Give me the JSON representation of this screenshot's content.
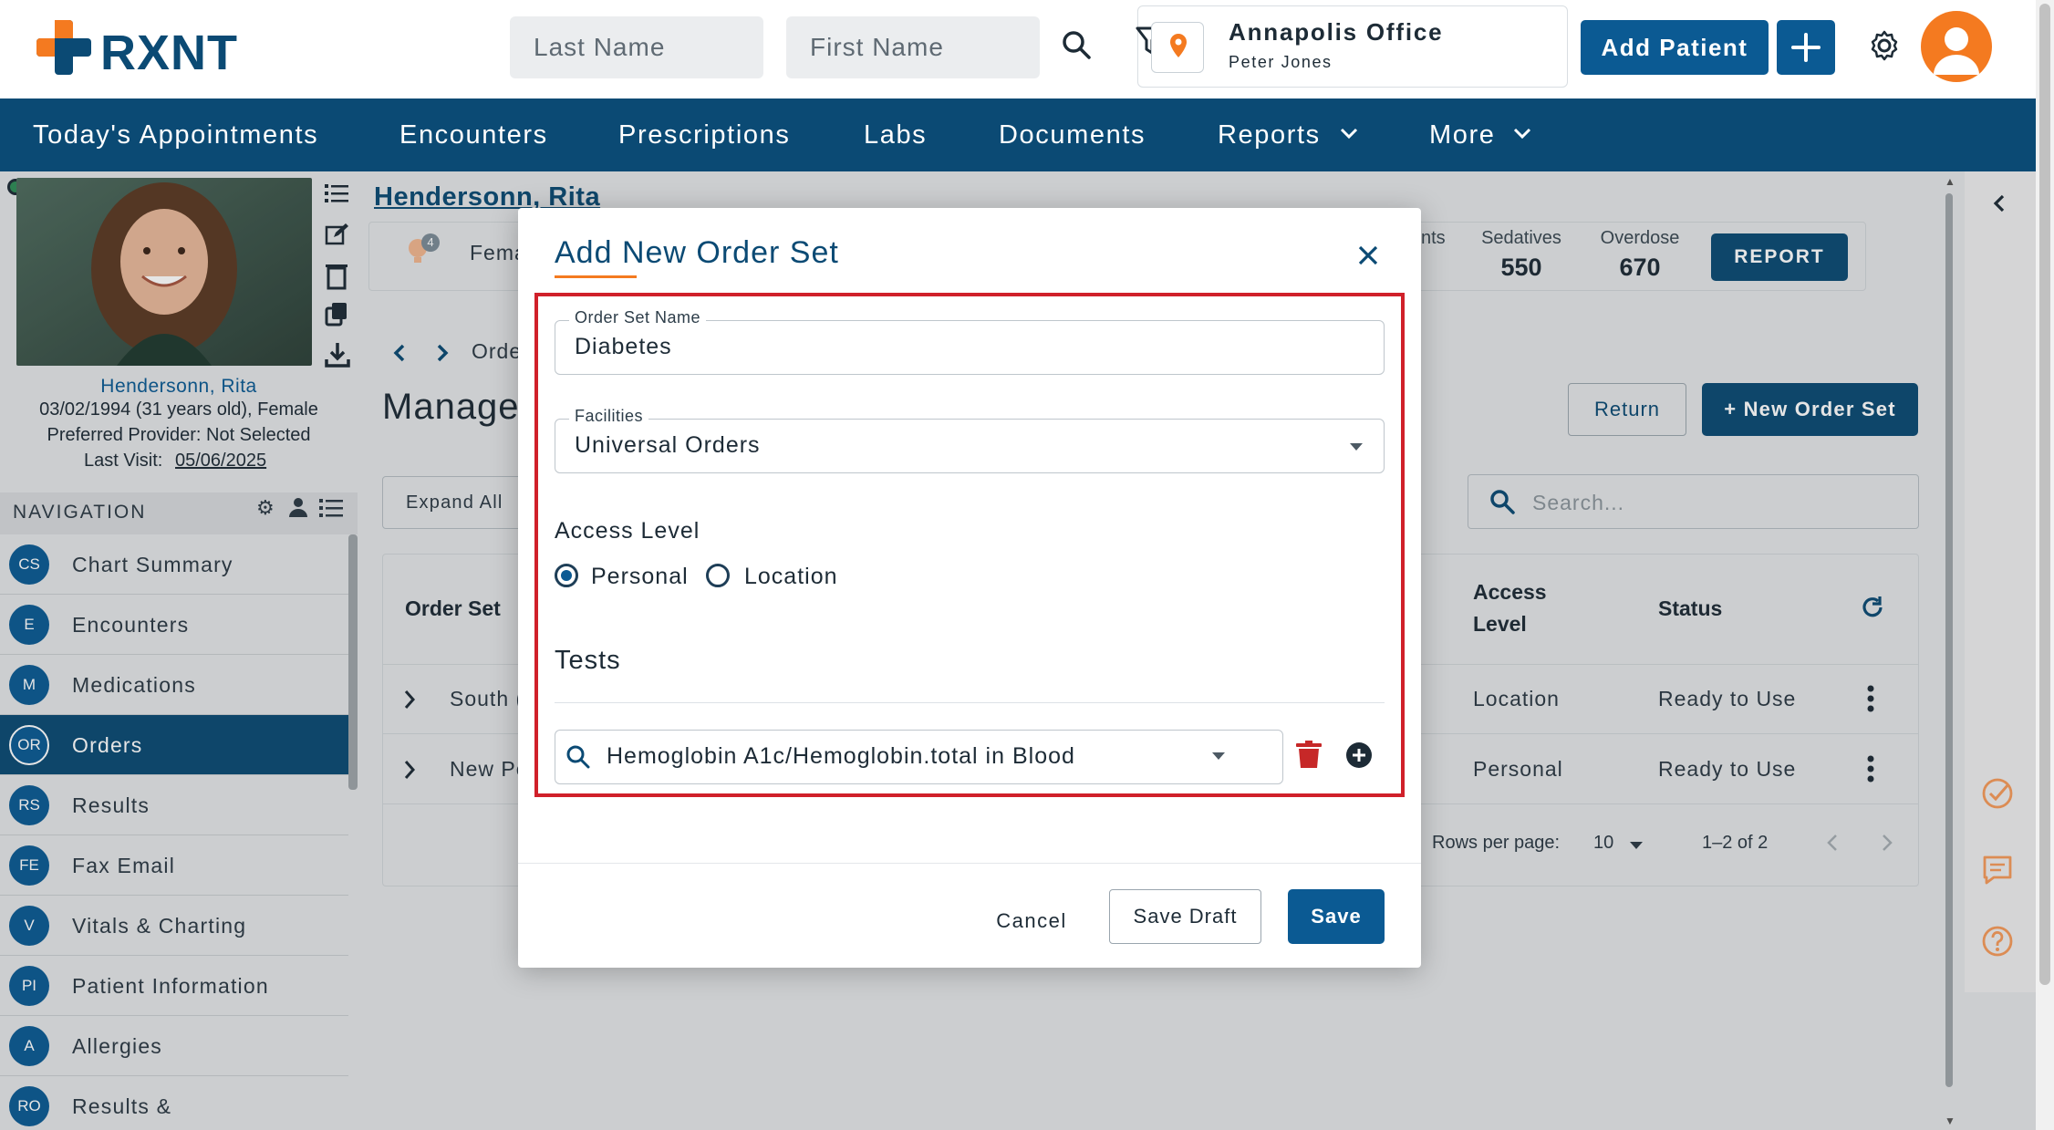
{
  "header": {
    "logo_text": "RXNT",
    "last_name_placeholder": "Last Name",
    "first_name_placeholder": "First Name",
    "location_name": "Annapolis Office",
    "location_user": "Peter Jones",
    "add_patient_label": "Add Patient"
  },
  "nav": {
    "items": [
      "Today's Appointments",
      "Encounters",
      "Prescriptions",
      "Labs",
      "Documents",
      "Reports",
      "More"
    ]
  },
  "patient": {
    "name_title": "Hendersonn, Rita",
    "name_link": "Hendersonn, Rita",
    "dob_line": "03/02/1994 (31 years old), Female",
    "provider_line": "Preferred Provider: Not Selected",
    "last_visit_label": "Last Visit:",
    "last_visit_date": "05/06/2025",
    "notification_count": "4",
    "gender_short": "Fema",
    "stats": [
      {
        "label": "nts",
        "value": ""
      },
      {
        "label": "Sedatives",
        "value": "550"
      },
      {
        "label": "Overdose",
        "value": "670"
      }
    ],
    "report_label": "REPORT"
  },
  "sidebar": {
    "section_title": "NAVIGATION",
    "items": [
      {
        "badge": "CS",
        "label": "Chart Summary"
      },
      {
        "badge": "E",
        "label": "Encounters"
      },
      {
        "badge": "M",
        "label": "Medications"
      },
      {
        "badge": "OR",
        "label": "Orders",
        "active": true
      },
      {
        "badge": "RS",
        "label": "Results"
      },
      {
        "badge": "FE",
        "label": "Fax Email"
      },
      {
        "badge": "V",
        "label": "Vitals & Charting"
      },
      {
        "badge": "PI",
        "label": "Patient Information"
      },
      {
        "badge": "A",
        "label": "Allergies"
      },
      {
        "badge": "RO",
        "label": "Results &"
      }
    ]
  },
  "main": {
    "breadcrumb": "Orde",
    "page_title": "Manage",
    "return_label": "Return",
    "new_order_set_label": "+ New Order Set",
    "expand_all_label": "Expand All",
    "search_placeholder": "Search...",
    "table": {
      "col_order_set": "Order Set",
      "col_access_level_1": "Access",
      "col_access_level_2": "Level",
      "col_status": "Status",
      "rows": [
        {
          "name": "South (",
          "access": "Location",
          "status": "Ready to Use"
        },
        {
          "name": "New Pe",
          "access": "Personal",
          "status": "Ready to Use"
        }
      ],
      "rows_per_page_label": "Rows per page:",
      "rows_per_page_value": "10",
      "pagination": "1–2 of 2"
    }
  },
  "modal": {
    "title": "Add New Order Set",
    "order_set_name_label": "Order Set Name",
    "order_set_name_value": "Diabetes",
    "facilities_label": "Facilities",
    "facilities_value": "Universal Orders",
    "access_level_label": "Access Level",
    "access_options": [
      "Personal",
      "Location"
    ],
    "access_selected": "Personal",
    "tests_label": "Tests",
    "test_value": "Hemoglobin A1c/Hemoglobin.total in Blood",
    "cancel_label": "Cancel",
    "save_draft_label": "Save Draft",
    "save_label": "Save"
  },
  "colors": {
    "brand_blue": "#0b4a74",
    "button_blue": "#0b5a93",
    "accent_orange": "#f47a20",
    "highlight_red": "#d0202a"
  }
}
